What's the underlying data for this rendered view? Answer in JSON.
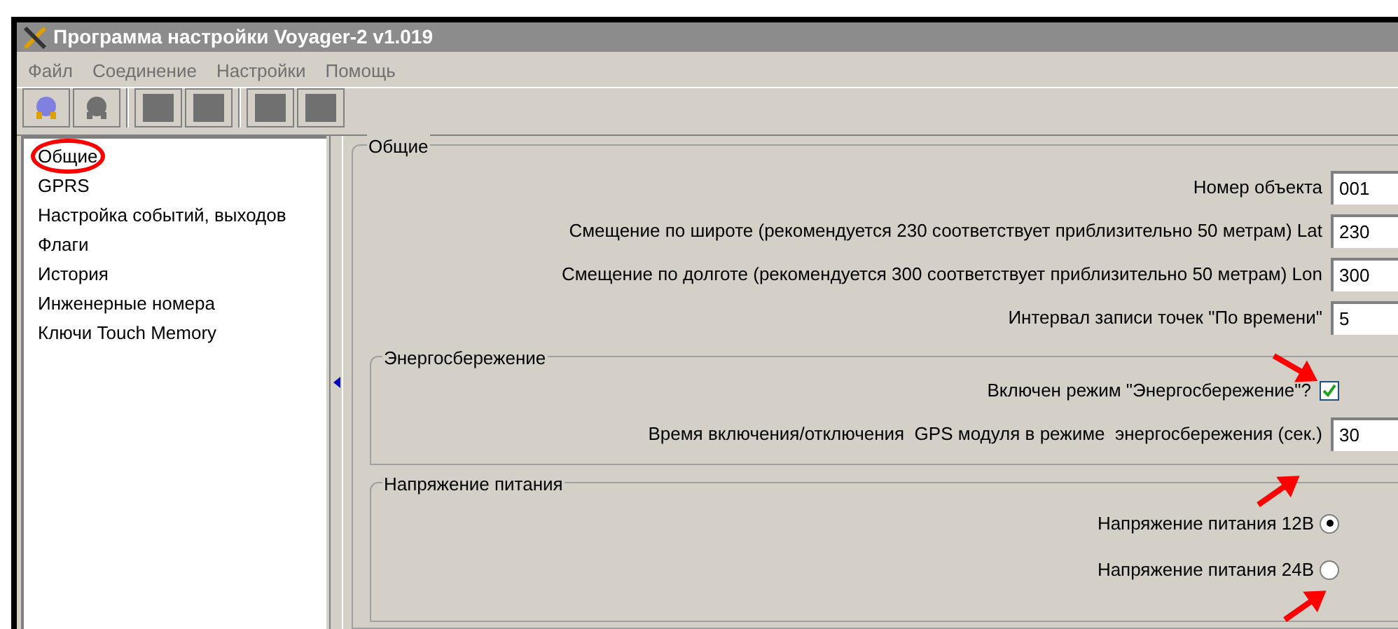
{
  "window": {
    "title": "Программа настройки Voyager-2 v1.019"
  },
  "menu": [
    "Файл",
    "Соединение",
    "Настройки",
    "Помощь"
  ],
  "sidebar": {
    "items": [
      {
        "label": "Общие",
        "circled": true
      },
      {
        "label": "GPRS",
        "circled": false
      },
      {
        "label": "Настройка событий, выходов",
        "circled": false
      },
      {
        "label": "Флаги",
        "circled": false
      },
      {
        "label": "История",
        "circled": false
      },
      {
        "label": "Инженерные номера",
        "circled": false
      },
      {
        "label": "Ключи Touch Memory",
        "circled": false
      }
    ]
  },
  "general": {
    "title": "Общие",
    "fields": [
      {
        "label": "Номер объекта",
        "value": "001"
      },
      {
        "label": "Смещение по широте (рекомендуется 230 соответствует приблизительно 50 метрам) Lat",
        "value": "230"
      },
      {
        "label": "Смещение по долготе (рекомендуется 300 соответствует приблизительно 50 метрам) Lon",
        "value": "300"
      },
      {
        "label": "Интервал записи точек \"По времени\"",
        "value": "5"
      }
    ]
  },
  "power_saving": {
    "title": "Энергосбережение",
    "checkbox": {
      "label": "Включен режим \"Энергосбережение\"?",
      "checked": true
    },
    "field": {
      "label": "Время включения/отключения  GPS модуля в режиме  энергосбережения (сек.)",
      "value": "30"
    }
  },
  "voltage": {
    "title": "Напряжение питания",
    "options": [
      {
        "label": "Напряжение питания 12В",
        "selected": true
      },
      {
        "label": "Напряжение питания 24В",
        "selected": false
      }
    ]
  }
}
